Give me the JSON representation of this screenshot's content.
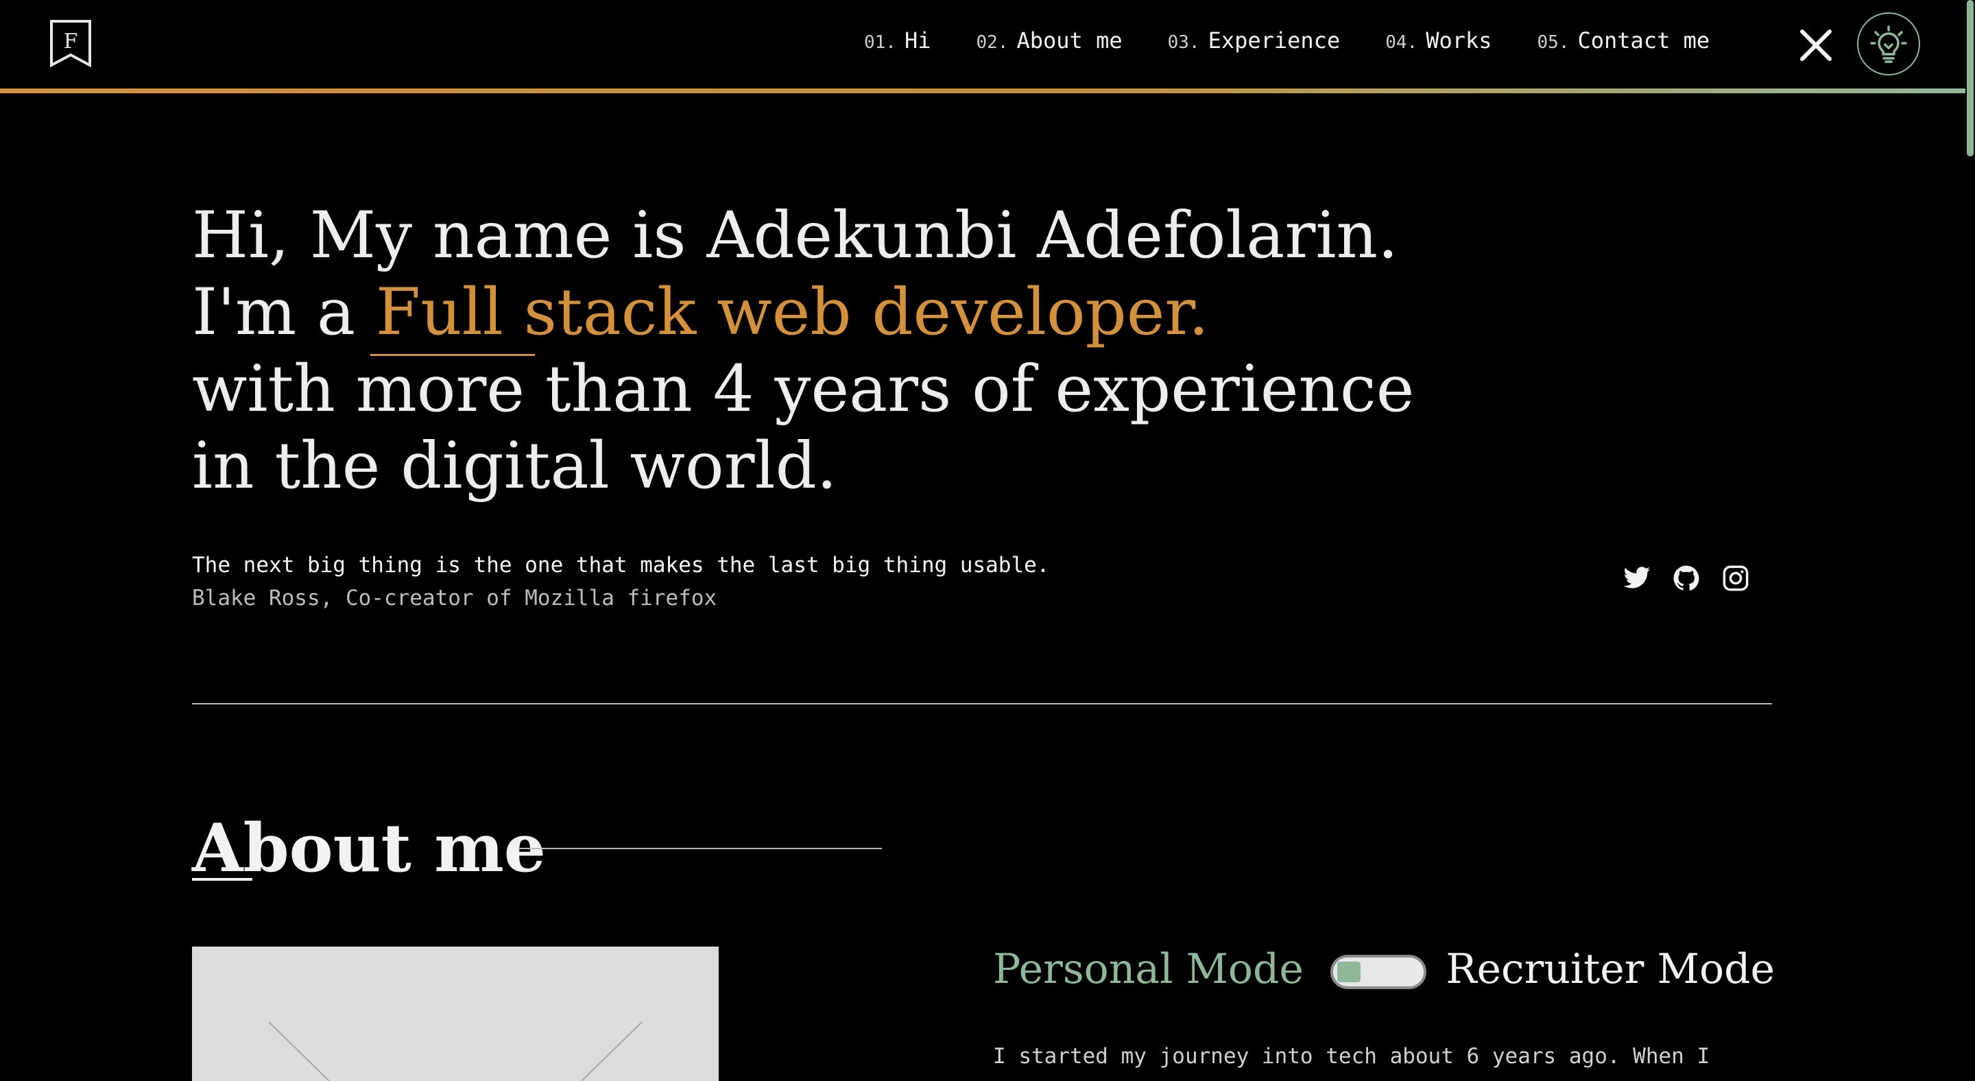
{
  "header": {
    "logo_letter": "F",
    "nav": [
      {
        "num": "01.",
        "label": "Hi"
      },
      {
        "num": "02.",
        "label": "About me"
      },
      {
        "num": "03.",
        "label": "Experience"
      },
      {
        "num": "04.",
        "label": "Works"
      },
      {
        "num": "05.",
        "label": "Contact me"
      }
    ],
    "close_icon": "close-icon",
    "theme_icon": "lightbulb-icon"
  },
  "hero": {
    "line1": "Hi, My name is Adekunbi Adefolarin.",
    "line2_prefix": "I'm a ",
    "line2_accent": "Full stack web developer.",
    "line3": "with more than 4 years of experience",
    "line4": "in the digital world.",
    "quote": "The next big thing is the one that makes the last big thing usable.",
    "quote_author": "Blake Ross, Co-creator of Mozilla firefox",
    "socials": [
      "twitter-icon",
      "github-icon",
      "instagram-icon"
    ]
  },
  "about": {
    "title": "About me",
    "mode_personal": "Personal Mode",
    "mode_recruiter": "Recruiter Mode",
    "bio_line1": "I started my journey into tech about 6 years ago. When I"
  },
  "colors": {
    "accent": "#d4913a",
    "green": "#8fb898",
    "background": "#000000",
    "text": "#ececec"
  }
}
